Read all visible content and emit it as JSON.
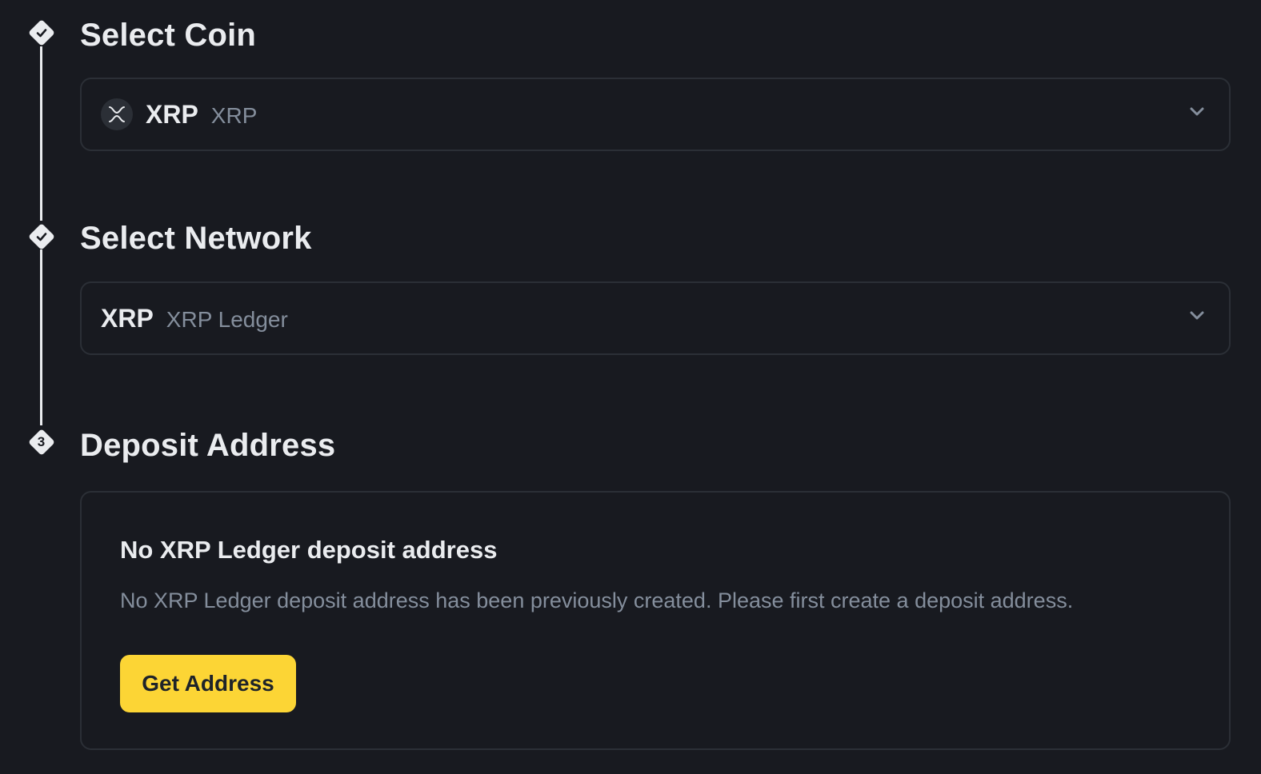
{
  "steps": [
    {
      "marker": "check",
      "title": "Select Coin"
    },
    {
      "marker": "check",
      "title": "Select Network"
    },
    {
      "marker": "3",
      "title": "Deposit Address"
    }
  ],
  "coin_select": {
    "symbol": "XRP",
    "name": "XRP",
    "icon": "xrp-coin-icon"
  },
  "network_select": {
    "symbol": "XRP",
    "name": "XRP Ledger"
  },
  "deposit_card": {
    "title": "No XRP Ledger deposit address",
    "description": "No XRP Ledger deposit address has been previously created. Please first create a deposit address.",
    "button_label": "Get Address"
  },
  "colors": {
    "background": "#181a20",
    "border": "#2b2f36",
    "primary_text": "#eaecef",
    "secondary_text": "#848e9c",
    "accent": "#fcd535"
  }
}
